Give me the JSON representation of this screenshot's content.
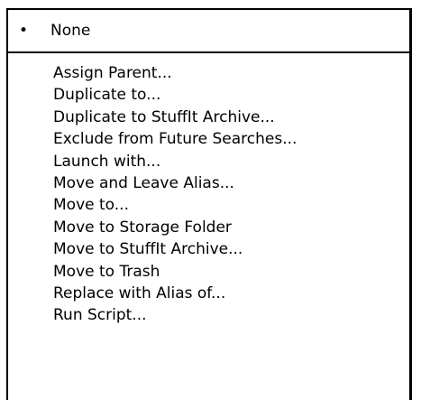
{
  "menu": {
    "selected": {
      "bullet": "•",
      "label": "None"
    },
    "items": [
      {
        "label": "Assign Parent..."
      },
      {
        "label": "Duplicate to..."
      },
      {
        "label": "Duplicate to StuffIt Archive..."
      },
      {
        "label": "Exclude from Future Searches..."
      },
      {
        "label": "Launch with..."
      },
      {
        "label": "Move and Leave Alias..."
      },
      {
        "label": "Move to..."
      },
      {
        "label": "Move to Storage Folder"
      },
      {
        "label": "Move to StuffIt Archive..."
      },
      {
        "label": "Move to Trash"
      },
      {
        "label": "Replace with Alias of..."
      },
      {
        "label": "Run Script..."
      }
    ]
  }
}
